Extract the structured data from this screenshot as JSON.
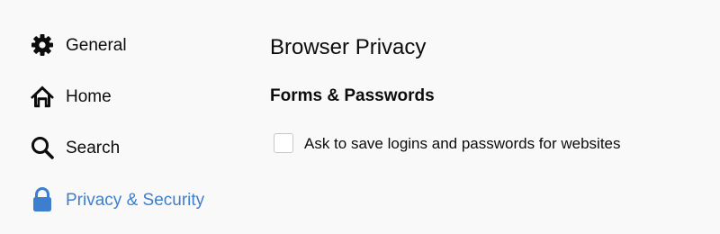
{
  "theme": {
    "accent": "#3d7fce",
    "icon_color": "#0c0c0d"
  },
  "sidebar": {
    "items": [
      {
        "label": "General",
        "icon": "gear-icon",
        "selected": false
      },
      {
        "label": "Home",
        "icon": "home-icon",
        "selected": false
      },
      {
        "label": "Search",
        "icon": "search-icon",
        "selected": false
      },
      {
        "label": "Privacy & Security",
        "icon": "lock-icon",
        "selected": true
      }
    ]
  },
  "main": {
    "page_title": "Browser Privacy",
    "section_title": "Forms & Passwords",
    "checkbox": {
      "label": "Ask to save logins and passwords for websites",
      "checked": false
    }
  }
}
